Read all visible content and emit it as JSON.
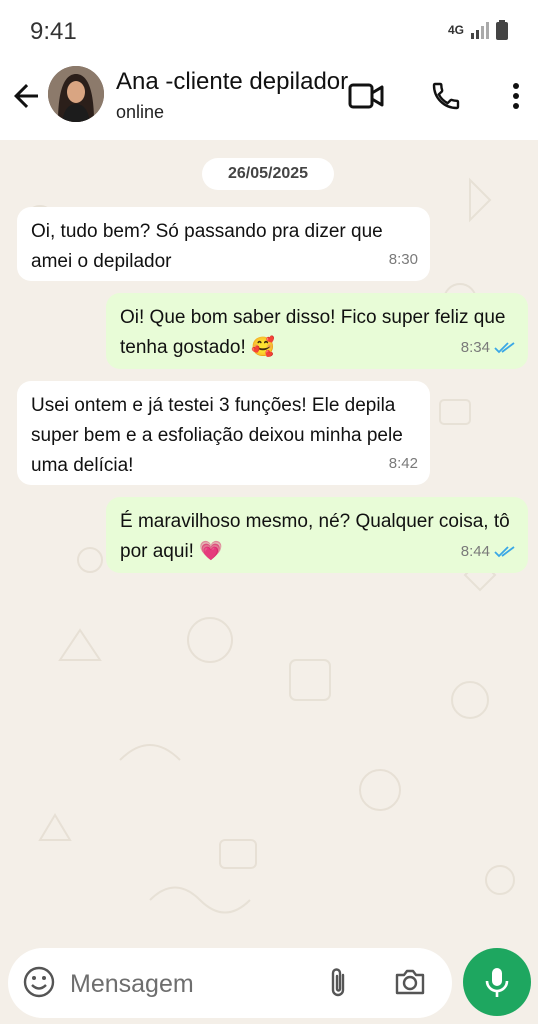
{
  "status_bar": {
    "time": "9:41",
    "network": "4G"
  },
  "header": {
    "contact_name": "Ana -cliente depilador",
    "contact_status": "online",
    "icons": [
      "back-arrow-icon",
      "video-call-icon",
      "phone-icon",
      "more-vert-icon"
    ]
  },
  "chat": {
    "date_chip": "26/05/2025",
    "messages": [
      {
        "direction": "incoming",
        "text": "Oi, tudo bem? Só passando pra dizer que amei o depilador",
        "time": "8:30"
      },
      {
        "direction": "outgoing",
        "text": "Oi! Que bom saber disso! Fico super feliz que tenha gostado! 🥰",
        "time": "8:34",
        "read": true
      },
      {
        "direction": "incoming",
        "text": "Usei ontem e já testei 3 funções! Ele depila super bem e a esfoliação deixou minha pele uma delícia!",
        "time": "8:42"
      },
      {
        "direction": "outgoing",
        "text": "É maravilhoso mesmo, né? Qualquer coisa, tô por aqui! 💗",
        "time": "8:44",
        "read": true
      }
    ]
  },
  "composer": {
    "placeholder": "Mensagem",
    "icons": [
      "emoji-icon",
      "attach-icon",
      "camera-icon",
      "mic-icon"
    ]
  },
  "colors": {
    "accent": "#1ea760",
    "outgoing_bubble": "#e8fcd7",
    "read_ticks": "#3aa7e6"
  }
}
